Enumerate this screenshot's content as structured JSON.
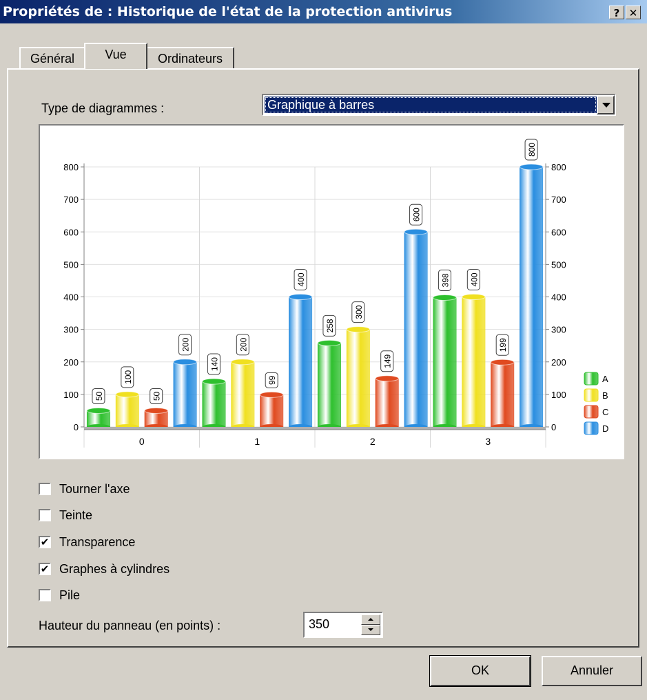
{
  "window": {
    "title": "Propriétés de : Historique de l'état de la protection antivirus",
    "help": "?",
    "close": "✕"
  },
  "tabs": [
    {
      "label": "Général"
    },
    {
      "label": "Vue"
    },
    {
      "label": "Ordinateurs"
    }
  ],
  "active_tab": "Vue",
  "chart_type": {
    "label": "Type de diagrammes :",
    "value": "Graphique à barres"
  },
  "chart_data": {
    "type": "bar",
    "style": "3d-cylinder",
    "categories": [
      "0",
      "1",
      "2",
      "3"
    ],
    "series": [
      {
        "name": "A",
        "color": "#2ec02e",
        "values": [
          50,
          140,
          258,
          398
        ]
      },
      {
        "name": "B",
        "color": "#f0e020",
        "values": [
          100,
          200,
          300,
          400
        ]
      },
      {
        "name": "C",
        "color": "#e04a20",
        "values": [
          50,
          99,
          149,
          199
        ]
      },
      {
        "name": "D",
        "color": "#2a8ee0",
        "values": [
          200,
          400,
          600,
          800
        ]
      }
    ],
    "y_ticks": [
      "0",
      "100",
      "200",
      "300",
      "400",
      "500",
      "600",
      "700",
      "800"
    ],
    "ylim": [
      0,
      800
    ],
    "legend_position": "right",
    "grid": true,
    "data_labels": true
  },
  "options": [
    {
      "label": "Tourner l'axe",
      "checked": false
    },
    {
      "label": "Teinte",
      "checked": false
    },
    {
      "label": "Transparence",
      "checked": true
    },
    {
      "label": "Graphes à cylindres",
      "checked": true
    },
    {
      "label": "Pile",
      "checked": false
    }
  ],
  "check_mark": "✔",
  "panel_height": {
    "label": "Hauteur du panneau (en points) :",
    "value": "350"
  },
  "buttons": {
    "ok": "OK",
    "cancel": "Annuler"
  }
}
